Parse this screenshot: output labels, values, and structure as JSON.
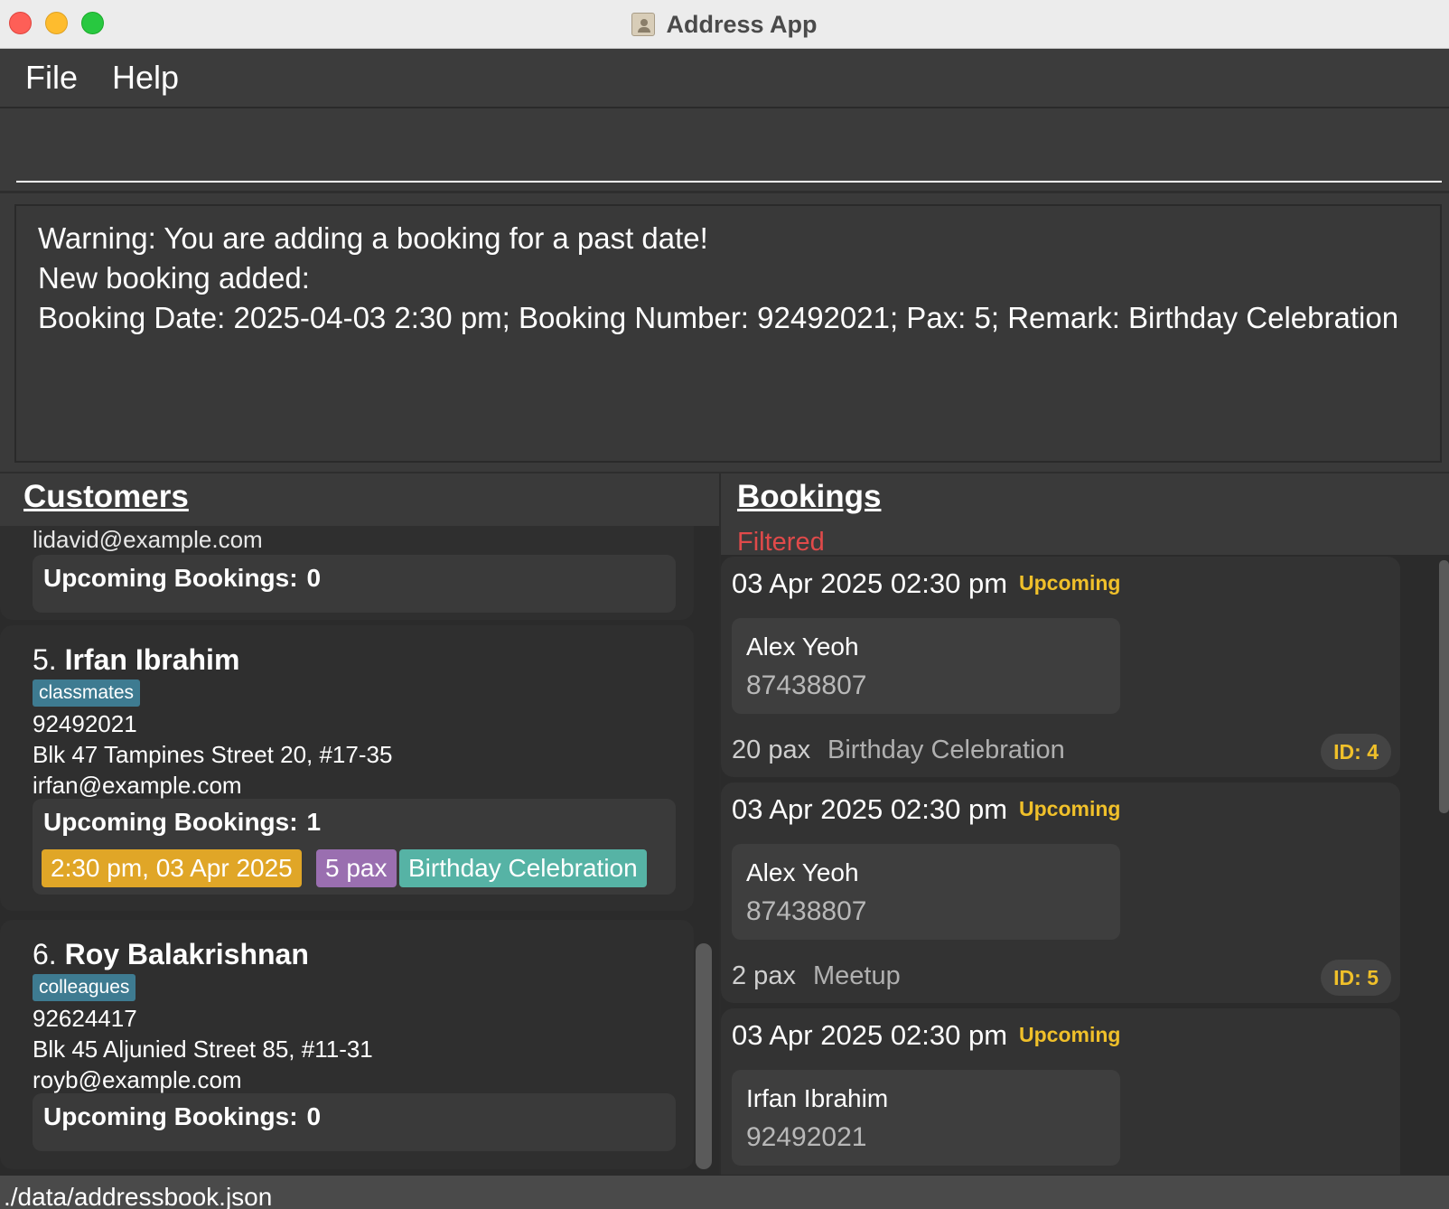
{
  "window": {
    "title": "Address App"
  },
  "menu": {
    "file": "File",
    "help": "Help"
  },
  "command": {
    "value": ""
  },
  "result": {
    "line1": "Warning: You are adding a booking for a past date!",
    "line2": "New booking added:",
    "line3": "Booking Date: 2025-04-03 2:30 pm; Booking Number: 92492021; Pax: 5; Remark: Birthday Celebration"
  },
  "customers": {
    "title": "Customers",
    "partial": {
      "email": "lidavid@example.com",
      "upcoming_label": "Upcoming Bookings:",
      "upcoming_count": "0"
    },
    "cards": [
      {
        "index": "5.",
        "name": "Irfan Ibrahim",
        "tag": "classmates",
        "phone": "92492021",
        "address": "Blk 47 Tampines Street 20, #17-35",
        "email": "irfan@example.com",
        "upcoming_label": "Upcoming Bookings:",
        "upcoming_count": "1",
        "booking": {
          "time": "2:30 pm, 03 Apr 2025",
          "pax": "5 pax",
          "remark": "Birthday Celebration"
        }
      },
      {
        "index": "6.",
        "name": "Roy Balakrishnan",
        "tag": "colleagues",
        "phone": "92624417",
        "address": "Blk 45 Aljunied Street 85, #11-31",
        "email": "royb@example.com",
        "upcoming_label": "Upcoming Bookings:",
        "upcoming_count": "0"
      }
    ]
  },
  "bookings": {
    "title": "Bookings",
    "filter_label": "Filtered",
    "items": [
      {
        "date": "03 Apr 2025 02:30 pm",
        "status": "Upcoming",
        "customer": "Alex Yeoh",
        "phone": "87438807",
        "pax": "20 pax",
        "remark": "Birthday Celebration",
        "id": "ID: 4"
      },
      {
        "date": "03 Apr 2025 02:30 pm",
        "status": "Upcoming",
        "customer": "Alex Yeoh",
        "phone": "87438807",
        "pax": "2 pax",
        "remark": "Meetup",
        "id": "ID: 5"
      },
      {
        "date": "03 Apr 2025 02:30 pm",
        "status": "Upcoming",
        "customer": "Irfan Ibrahim",
        "phone": "92492021"
      }
    ]
  },
  "status_bar": {
    "path": "./data/addressbook.json"
  },
  "colors": {
    "status_upcoming": "#f0c02a",
    "filtered": "#e04a4a",
    "tag": "#3e7b91",
    "chip_time": "#e0a627",
    "chip_pax": "#9a6fb0",
    "chip_remark": "#56b3a5"
  }
}
